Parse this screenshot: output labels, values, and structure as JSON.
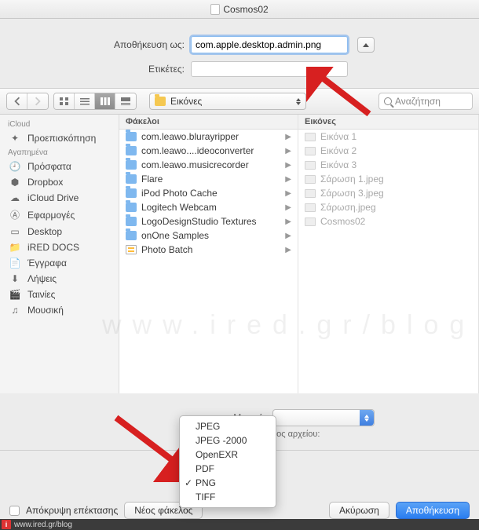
{
  "title": "Cosmos02",
  "save_as_label": "Αποθήκευση ως:",
  "save_as_value": "com.apple.desktop.admin.png",
  "tags_label": "Ετικέτες:",
  "location_label": "Εικόνες",
  "search_placeholder": "Αναζήτηση",
  "sidebar": {
    "sections": [
      {
        "header": "iCloud",
        "items": [
          "Προεπισκόπηση"
        ]
      },
      {
        "header": "Αγαπημένα",
        "items": [
          "Πρόσφατα",
          "Dropbox",
          "iCloud Drive",
          "Εφαρμογές",
          "Desktop",
          "iRED DOCS",
          "Έγγραφα",
          "Λήψεις",
          "Ταινίες",
          "Μουσική"
        ]
      }
    ]
  },
  "columns": {
    "col1_header": "Φάκελοι",
    "col1_items": [
      "com.leawo.blurayripper",
      "com.leawo....ideoconverter",
      "com.leawo.musicrecorder",
      "Flare",
      "iPod Photo Cache",
      "Logitech Webcam",
      "LogoDesignStudio Textures",
      "onOne Samples",
      "Photo Batch"
    ],
    "col2_header": "Εικόνες",
    "col2_items": [
      "Εικόνα 1",
      "Εικόνα 2",
      "Εικόνα 3",
      "Σάρωση 1.jpeg",
      "Σάρωση 3.jpeg",
      "Σάρωση.jpeg",
      "Cosmos02"
    ]
  },
  "format_label": "Μορφή:",
  "filesize_label": "Μέγεθος αρχείου:",
  "format_menu": [
    "JPEG",
    "JPEG -2000",
    "OpenEXR",
    "PDF",
    "PNG",
    "TIFF"
  ],
  "format_selected": "PNG",
  "hide_ext_label": "Απόκρυψη επέκτασης",
  "new_folder_btn": "Νέος φάκελος",
  "cancel_btn": "Ακύρωση",
  "save_btn": "Αποθήκευση",
  "watermark": "www.ired.gr/blog",
  "footer_url": "www.ired.gr/blog"
}
